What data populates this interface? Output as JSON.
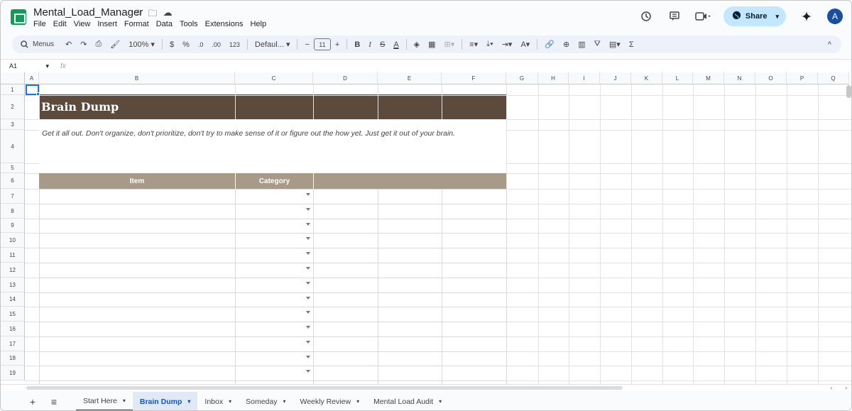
{
  "app": {
    "doc_title": "Mental_Load_Manager",
    "menu": [
      "File",
      "Edit",
      "View",
      "Insert",
      "Format",
      "Data",
      "Tools",
      "Extensions",
      "Help"
    ],
    "share_label": "Share",
    "avatar_initial": "A"
  },
  "toolbar": {
    "search_label": "Menus",
    "zoom": "100%",
    "currency": "$",
    "percent": "%",
    "dec_decrease": ".0",
    "dec_increase": ".00",
    "number_format": "123",
    "font": "Defaul...",
    "font_size": "11",
    "minus": "−",
    "plus": "+",
    "bold": "B",
    "italic": "I",
    "strike": "S",
    "text_color": "A",
    "sigma": "Σ"
  },
  "formula_bar": {
    "cell_ref": "A1",
    "fx": "fx",
    "formula": ""
  },
  "grid": {
    "columns": [
      "A",
      "B",
      "C",
      "D",
      "E",
      "F",
      "G",
      "H",
      "I",
      "J",
      "K",
      "L",
      "M",
      "N",
      "O",
      "P",
      "Q"
    ],
    "rows": [
      "1",
      "2",
      "3",
      "4",
      "5",
      "6",
      "7",
      "8",
      "9",
      "10",
      "11",
      "12",
      "13",
      "14",
      "15",
      "16",
      "17",
      "18",
      "19"
    ]
  },
  "sheet": {
    "title": "Brain Dump",
    "description": "Get it all out. Don't organize, don't prioritize, don't try to make sense of it or figure out the how yet. Just get it out of your brain.",
    "headers": {
      "item": "Item",
      "category": "Category"
    },
    "banner_color": "#5c4a3d",
    "header_color": "#a89a88"
  },
  "tabs": [
    {
      "label": "Start Here"
    },
    {
      "label": "Brain Dump"
    },
    {
      "label": "Inbox"
    },
    {
      "label": "Someday"
    },
    {
      "label": "Weekly Review"
    },
    {
      "label": "Mental Load Audit"
    }
  ],
  "icons": {
    "add_sheet": "+",
    "all_sheets": "≡",
    "collapse_toolbar": "^"
  }
}
